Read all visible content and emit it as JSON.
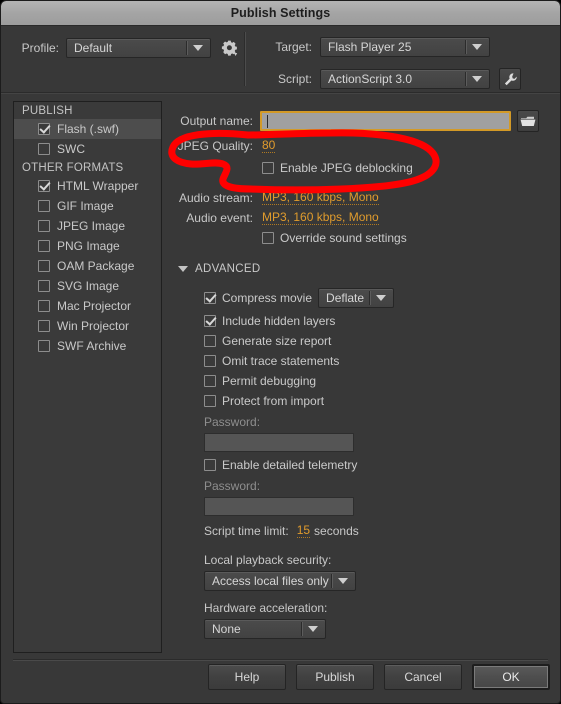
{
  "window": {
    "title": "Publish Settings"
  },
  "header": {
    "profile_label": "Profile:",
    "profile_value": "Default",
    "profile_settings_icon": "gear-icon",
    "target_label": "Target:",
    "target_value": "Flash Player 25",
    "script_label": "Script:",
    "script_value": "ActionScript 3.0",
    "script_settings_icon": "wrench-icon"
  },
  "formats": {
    "group_publish": "PUBLISH",
    "group_other": "OTHER FORMATS",
    "publish_items": [
      {
        "label": "Flash (.swf)",
        "checked": true,
        "selected": true
      },
      {
        "label": "SWC",
        "checked": false,
        "selected": false
      }
    ],
    "other_items": [
      {
        "label": "HTML Wrapper",
        "checked": true
      },
      {
        "label": "GIF Image",
        "checked": false
      },
      {
        "label": "JPEG Image",
        "checked": false
      },
      {
        "label": "PNG Image",
        "checked": false
      },
      {
        "label": "OAM Package",
        "checked": false
      },
      {
        "label": "SVG Image",
        "checked": false
      },
      {
        "label": "Mac Projector",
        "checked": false
      },
      {
        "label": "Win Projector",
        "checked": false
      },
      {
        "label": "SWF Archive",
        "checked": false
      }
    ]
  },
  "main": {
    "output_name_label": "Output name:",
    "output_name_value": "",
    "output_name_placeholder": "",
    "browse_icon": "folder-icon",
    "jpeg_quality_label": "JPEG Quality:",
    "jpeg_quality_value": "80",
    "jpeg_deblocking_label": "Enable JPEG deblocking",
    "jpeg_deblocking_checked": false,
    "audio_stream_label": "Audio stream:",
    "audio_stream_value": "MP3, 160 kbps, Mono",
    "audio_event_label": "Audio event:",
    "audio_event_value": "MP3, 160 kbps, Mono",
    "override_sound_label": "Override sound settings",
    "override_sound_checked": false,
    "advanced_header": "ADVANCED",
    "compress_movie_label": "Compress movie",
    "compress_movie_checked": true,
    "compress_movie_value": "Deflate",
    "include_hidden_layers_label": "Include hidden layers",
    "include_hidden_layers_checked": true,
    "generate_size_report_label": "Generate size report",
    "generate_size_report_checked": false,
    "omit_trace_label": "Omit trace statements",
    "omit_trace_checked": false,
    "permit_debugging_label": "Permit debugging",
    "permit_debugging_checked": false,
    "protect_import_label": "Protect from import",
    "protect_import_checked": false,
    "password_label_1": "Password:",
    "password_value_1": "",
    "telemetry_label": "Enable detailed telemetry",
    "telemetry_checked": false,
    "password_label_2": "Password:",
    "password_value_2": "",
    "script_time_limit_label": "Script time limit:",
    "script_time_limit_value": "15",
    "script_time_limit_unit": "seconds",
    "local_playback_label": "Local playback security:",
    "local_playback_value": "Access local files only",
    "hardware_accel_label": "Hardware acceleration:",
    "hardware_accel_value": "None"
  },
  "footer": {
    "help": "Help",
    "publish": "Publish",
    "cancel": "Cancel",
    "ok": "OK"
  },
  "annotation": {
    "type": "hand-drawn-ellipse",
    "color": "#ff0000",
    "encircles": "JPEG Quality: 80 / Enable JPEG deblocking"
  },
  "colors": {
    "dialog_bg": "#383838",
    "titlebar": "#a8a8a8",
    "link_orange": "#e09b2d",
    "focus_border": "#d39a27",
    "annotation_red": "#ff0000"
  }
}
